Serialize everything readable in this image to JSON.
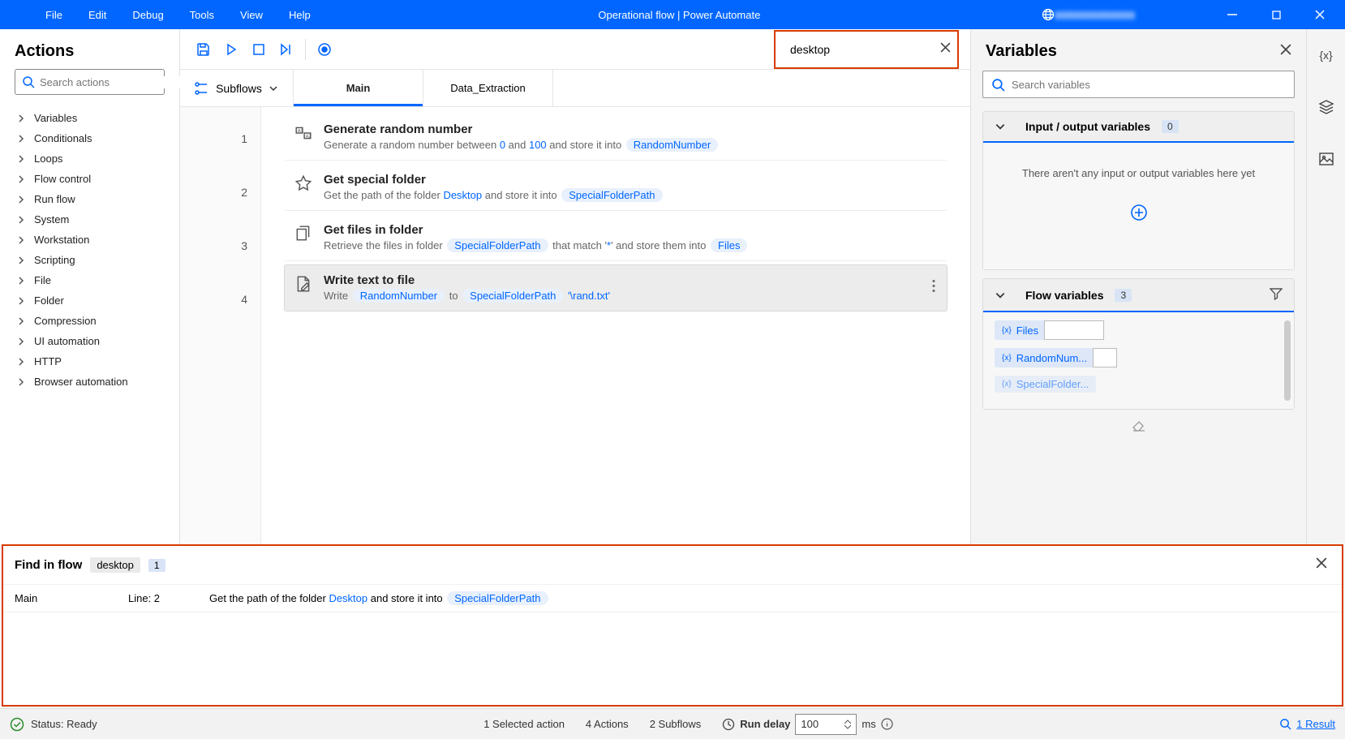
{
  "titlebar": {
    "menus": [
      "File",
      "Edit",
      "Debug",
      "Tools",
      "View",
      "Help"
    ],
    "title": "Operational flow | Power Automate"
  },
  "actions": {
    "title": "Actions",
    "search_placeholder": "Search actions",
    "categories": [
      "Variables",
      "Conditionals",
      "Loops",
      "Flow control",
      "Run flow",
      "System",
      "Workstation",
      "Scripting",
      "File",
      "Folder",
      "Compression",
      "UI automation",
      "HTTP",
      "Browser automation"
    ]
  },
  "subflows": {
    "label": "Subflows",
    "tabs": [
      "Main",
      "Data_Extraction"
    ]
  },
  "flow_search": {
    "value": "desktop"
  },
  "steps": [
    {
      "title": "Generate random number",
      "desc_parts": [
        "Generate a random number between ",
        {
          "hl": "0"
        },
        " and ",
        {
          "hl": "100"
        },
        " and store it into "
      ],
      "pill": "RandomNumber"
    },
    {
      "title": "Get special folder",
      "desc_parts": [
        "Get the path of the folder ",
        {
          "hl": "Desktop"
        },
        " and store it into "
      ],
      "pill": "SpecialFolderPath"
    },
    {
      "title": "Get files in folder",
      "desc_parts": [
        "Retrieve the files in folder "
      ],
      "mid_pill": "SpecialFolderPath",
      "after": [
        " that match '",
        {
          "hl": "*"
        },
        "' and store them into "
      ],
      "pill": "Files"
    },
    {
      "title": "Write text to file",
      "desc_parts": [
        "Write "
      ],
      "mid_pill": "RandomNumber",
      "between": "  to  ",
      "mid_pill2": "SpecialFolderPath",
      "suffix": " '\\rand.txt'"
    }
  ],
  "variables": {
    "title": "Variables",
    "search_placeholder": "Search variables",
    "io_section": {
      "title": "Input / output variables",
      "count": "0",
      "empty_msg": "There aren't any input or output variables here yet"
    },
    "flow_section": {
      "title": "Flow variables",
      "count": "3",
      "items": [
        "Files",
        "RandomNum...",
        "SpecialFolder..."
      ]
    }
  },
  "find": {
    "title": "Find in flow",
    "term": "desktop",
    "count": "1",
    "row": {
      "subflow": "Main",
      "line": "Line: 2",
      "desc_pre": "Get the path of the folder ",
      "hl": "Desktop",
      "desc_mid": " and store it into ",
      "pill": "SpecialFolderPath"
    }
  },
  "status": {
    "ready": "Status: Ready",
    "selected": "1 Selected action",
    "actions": "4 Actions",
    "subflows": "2 Subflows",
    "delay_label": "Run delay",
    "delay_value": "100",
    "delay_unit": "ms",
    "result": "1 Result"
  }
}
